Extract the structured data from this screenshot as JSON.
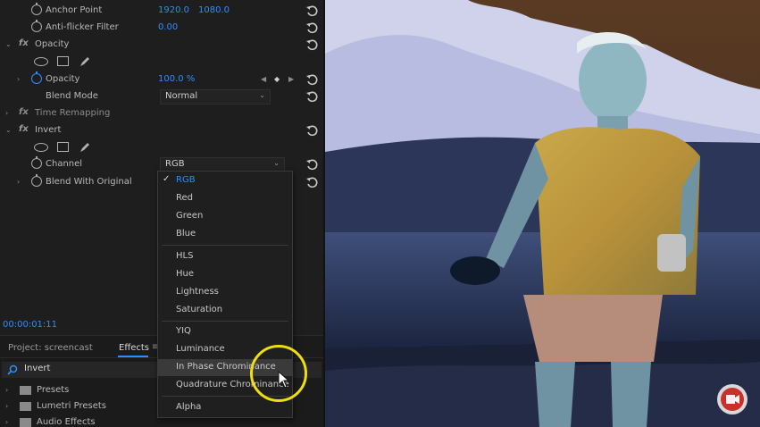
{
  "effect_controls": {
    "anchor_point": {
      "label": "Anchor Point",
      "x": "1920.0",
      "y": "1080.0"
    },
    "anti_flicker": {
      "label": "Anti-flicker Filter",
      "value": "0.00"
    },
    "opacity_section": {
      "label": "Opacity"
    },
    "opacity": {
      "label": "Opacity",
      "value": "100.0 %"
    },
    "blend_mode": {
      "label": "Blend Mode",
      "value": "Normal"
    },
    "time_remapping": {
      "label": "Time Remapping"
    },
    "invert_section": {
      "label": "Invert"
    },
    "channel": {
      "label": "Channel",
      "value": "RGB"
    },
    "blend_with_original": {
      "label": "Blend With Original"
    }
  },
  "timecode": "00:00:01:11",
  "channel_menu": {
    "items": [
      {
        "label": "RGB",
        "selected": true
      },
      {
        "label": "Red"
      },
      {
        "label": "Green"
      },
      {
        "label": "Blue"
      },
      {
        "label": "HLS"
      },
      {
        "label": "Hue"
      },
      {
        "label": "Lightness"
      },
      {
        "label": "Saturation"
      },
      {
        "label": "YIQ"
      },
      {
        "label": "Luminance"
      },
      {
        "label": "In Phase Chrominance",
        "hovered": true
      },
      {
        "label": "Quadrature Chrominance"
      },
      {
        "label": "Alpha"
      }
    ]
  },
  "project_panel": {
    "project_tab": "Project: screencast",
    "effects_tab": "Effects",
    "search_value": "Invert",
    "folders": [
      "Presets",
      "Lumetri Presets",
      "Audio Effects"
    ]
  },
  "colors": {
    "accent": "#2f8cff",
    "panel": "#1e1e1e",
    "highlight": "#f0dd10"
  }
}
